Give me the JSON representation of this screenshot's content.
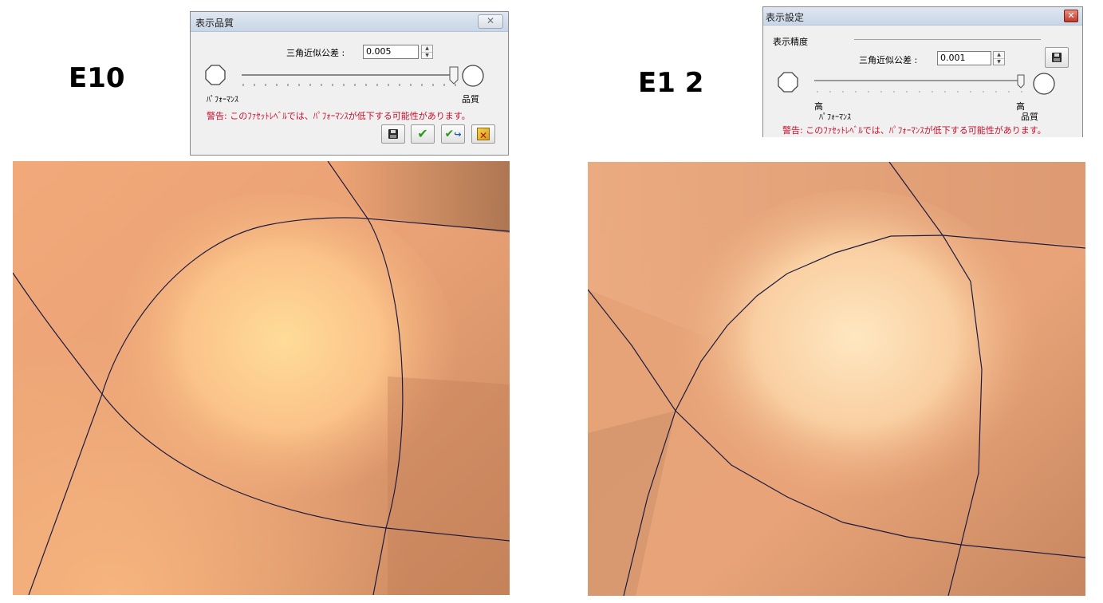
{
  "left": {
    "label": "E10",
    "dialog": {
      "title": "表示品質",
      "tolerance_label": "三角近似公差 :",
      "tolerance_value": "0.005",
      "perf_label": "ﾊﾟﾌｫｰﾏﾝｽ",
      "quality_label": "品質",
      "warning": "警告: このﾌｧｾｯﾄﾚﾍﾞﾙでは、ﾊﾟﾌｫｰﾏﾝｽが低下する可能性があります。",
      "slider_level": 1.0
    }
  },
  "right": {
    "label": "E1 2",
    "dialog": {
      "title": "表示設定",
      "section_label": "表示精度",
      "tolerance_label": "三角近似公差 :",
      "tolerance_value": "0.001",
      "high_left": "高",
      "perf_label": "ﾊﾟﾌｫｰﾏﾝｽ",
      "high_right": "高",
      "quality_label": "品質",
      "warning": "警告: このﾌｧｾｯﾄﾚﾍﾞﾙでは、ﾊﾟﾌｫｰﾏﾝｽが低下する可能性があります。",
      "slider_level": 1.0
    }
  },
  "icons": {
    "save": "save-icon",
    "ok": "checkmark-icon",
    "apply": "apply-icon",
    "cancel": "cancel-icon",
    "close": "close-icon"
  },
  "colors": {
    "warning": "#c8102e",
    "surface_light": "#fde2a8",
    "surface_mid": "#f0b07f",
    "surface_dark": "#b87750",
    "edge": "#1b1b40"
  }
}
